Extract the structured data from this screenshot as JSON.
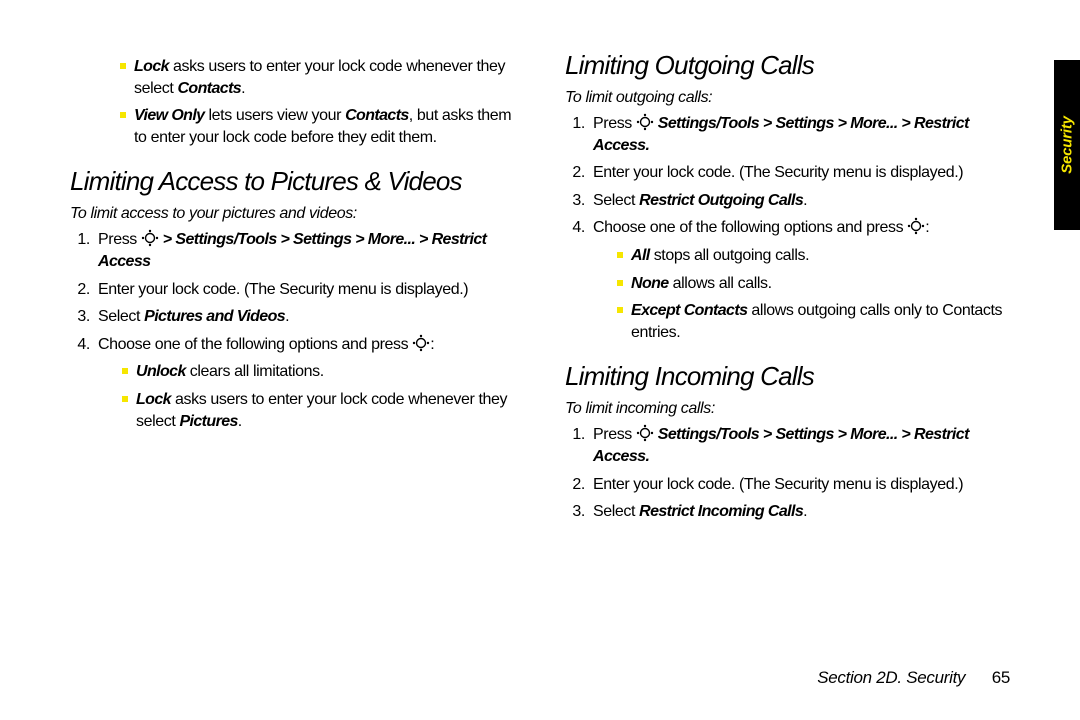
{
  "side_tab": "Security",
  "left": {
    "intro_bullets": [
      {
        "lead": "Lock",
        "rest": " asks users to enter your lock code whenever they select ",
        "tail_bold": "Contacts",
        "suffix": "."
      },
      {
        "lead": "View Only",
        "rest": " lets users view your ",
        "mid_bold": "Contacts",
        "rest2": ", but asks them to enter your lock code before they edit them."
      }
    ],
    "heading": "Limiting Access to Pictures & Videos",
    "sub": "To limit access to your pictures and videos:",
    "step1_pre": "Press ",
    "step1_path": " > Settings/Tools > Settings > More... > Restrict Access",
    "step2": "Enter your lock code. (The Security menu is displayed.)",
    "step3_pre": "Select ",
    "step3_bold": "Pictures and Videos",
    "step3_suf": ".",
    "step4_pre": "Choose one of the following options and press ",
    "step4_suf": ":",
    "sub_bullets": [
      {
        "lead": "Unlock",
        "rest": " clears all limitations."
      },
      {
        "lead": "Lock",
        "rest": " asks users to enter your lock code whenever they select ",
        "tail_bold": "Pictures",
        "suffix": "."
      }
    ]
  },
  "right": {
    "heading_out": "Limiting Outgoing Calls",
    "sub_out": "To limit outgoing calls:",
    "out_step1_pre": "Press ",
    "out_step1_path": " Settings/Tools > Settings > More... > Restrict Access",
    "out_step1_suf": ".",
    "out_step2": "Enter your lock code. (The Security menu is displayed.)",
    "out_step3_pre": "Select ",
    "out_step3_bold": "Restrict Outgoing Calls",
    "out_step3_suf": ".",
    "out_step4_pre": "Choose one of the following options and press ",
    "out_step4_suf": ":",
    "out_bullets": [
      {
        "lead": "All",
        "rest": " stops all outgoing calls."
      },
      {
        "lead": "None",
        "rest": " allows all calls."
      },
      {
        "lead": "Except Contacts",
        "rest": " allows outgoing calls only to Contacts entries."
      }
    ],
    "heading_in": "Limiting Incoming Calls",
    "sub_in": "To limit incoming calls:",
    "in_step1_pre": "Press ",
    "in_step1_path": " Settings/Tools > Settings > More... > Restrict Access",
    "in_step1_suf": ".",
    "in_step2": "Enter your lock code. (The Security menu is displayed.)",
    "in_step3_pre": "Select ",
    "in_step3_bold": "Restrict Incoming Calls",
    "in_step3_suf": "."
  },
  "footer": {
    "section": "Section 2D. Security",
    "page": "65"
  }
}
